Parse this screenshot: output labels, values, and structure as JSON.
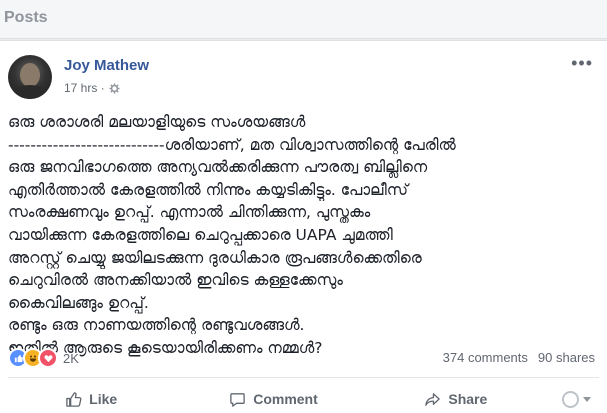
{
  "section": {
    "title": "Posts"
  },
  "post": {
    "author": "Joy Mathew",
    "time": "17 hrs · ",
    "privacy_icon": "gear-icon",
    "more_label": "•••",
    "lines": [
      "ഒരു ശരാശരി മലയാളിയുടെ സംശയങ്ങൾ",
      "----------------------------ശരിയാണ്, മത വിശ്വാസത്തിന്റെ പേരിൽ",
      "ഒരു ജനവിഭാഗത്തെ അന്യവൽക്കരിക്കുന്ന പൗരത്വ ബില്ലിനെ",
      "എതിർത്താൽ കേരളത്തിൽ നിന്നും കയ്യടികിട്ടും. പോലീസ്",
      "സംരക്ഷണവും ഉറപ്പ്. എന്നാൽ ചിന്തിക്കുന്ന, പുസ്തകം",
      "വായിക്കുന്ന കേരളത്തിലെ ചെറുപ്പക്കാരെ UAPA ചുമത്തി",
      "അറസ്റ്റ് ചെയ്യു ജയിലടക്കുന്ന ദുരധികാര രൂപങ്ങൾക്കെതിരെ",
      "ചെറുവിരൽ അനക്കിയാൽ ഇവിടെ കള്ളക്കേസും",
      "കൈവിലങ്ങും ഉറപ്പ്.",
      "രണ്ടും ഒരു നാണയത്തിന്റെ രണ്ടുവശങ്ങൾ.",
      "ഇതിൽ ആരുടെ കൂടെയായിരിക്കണം നമ്മൾ?"
    ],
    "reactions": {
      "count": "2K",
      "types": [
        "like",
        "haha",
        "love"
      ]
    },
    "comments": "374 comments",
    "shares": "90 shares",
    "actions": {
      "like": "Like",
      "comment": "Comment",
      "share": "Share"
    },
    "colors": {
      "author": "#365899",
      "like_blue": "#5890ff",
      "love_red": "#f25268",
      "haha_yellow": "#f7b125"
    }
  }
}
